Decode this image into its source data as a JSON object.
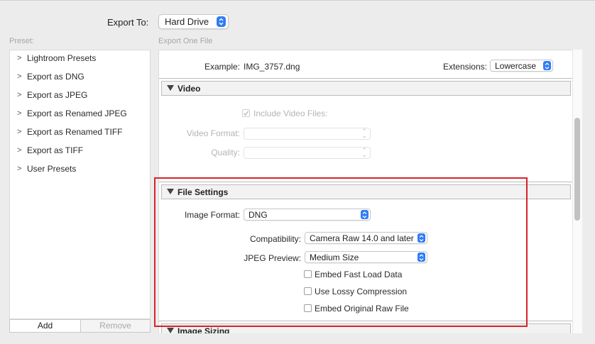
{
  "header": {
    "export_to_label": "Export To:",
    "export_to_value": "Hard Drive"
  },
  "sidebar": {
    "section_label": "Preset:",
    "items": [
      {
        "label": "Lightroom Presets"
      },
      {
        "label": "Export as DNG"
      },
      {
        "label": "Export as JPEG"
      },
      {
        "label": "Export as Renamed JPEG"
      },
      {
        "label": "Export as Renamed TIFF"
      },
      {
        "label": "Export as TIFF"
      },
      {
        "label": "User Presets"
      }
    ],
    "add_label": "Add",
    "remove_label": "Remove"
  },
  "main": {
    "section_label": "Export One File",
    "example_label": "Example:",
    "example_value": "IMG_3757.dng",
    "extensions_label": "Extensions:",
    "extensions_value": "Lowercase",
    "video": {
      "title": "Video",
      "include_label": "Include Video Files:",
      "format_label": "Video Format:",
      "quality_label": "Quality:"
    },
    "file_settings": {
      "title": "File Settings",
      "image_format_label": "Image Format:",
      "image_format_value": "DNG",
      "compatibility_label": "Compatibility:",
      "compatibility_value": "Camera Raw 14.0 and later",
      "jpeg_preview_label": "JPEG Preview:",
      "jpeg_preview_value": "Medium Size",
      "embed_fast_load_label": "Embed Fast Load Data",
      "lossy_label": "Use Lossy Compression",
      "embed_raw_label": "Embed Original Raw File"
    },
    "image_sizing": {
      "title": "Image Sizing"
    }
  },
  "colors": {
    "accent": "#2f7cf6",
    "highlight_box": "#d8232a"
  }
}
